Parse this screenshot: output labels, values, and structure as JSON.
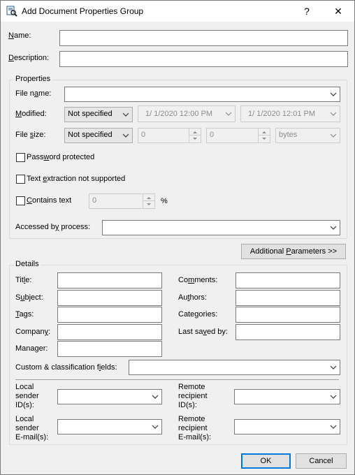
{
  "window": {
    "title": "Add Document Properties Group",
    "help_label": "?",
    "close_label": "✕"
  },
  "top": {
    "name_label": "Name:",
    "name_value": "",
    "description_label": "Description:",
    "description_value": ""
  },
  "properties": {
    "group_title": "Properties",
    "file_name_label": "File name:",
    "file_name_value": "",
    "modified_label": "Modified:",
    "modified_mode": "Not specified",
    "modified_from": "1/  1/2020 12:00 PM",
    "modified_to": "1/  1/2020 12:01 PM",
    "file_size_label": "File size:",
    "file_size_mode": "Not specified",
    "size_min": "0",
    "size_max": "0",
    "size_unit": "bytes",
    "password_protected_label": "Password protected",
    "text_extraction_label": "Text extraction not supported",
    "contains_text_label": "Contains text",
    "contains_text_value": "0",
    "percent_label": "%",
    "accessed_by_label": "Accessed by process:",
    "accessed_by_value": ""
  },
  "additional_parameters_label": "Additional Parameters >>",
  "details": {
    "group_title": "Details",
    "title_label": "Title:",
    "subject_label": "Subject:",
    "tags_label": "Tags:",
    "company_label": "Company:",
    "manager_label": "Manager:",
    "comments_label": "Comments:",
    "authors_label": "Authors:",
    "categories_label": "Categories:",
    "last_saved_label": "Last saved by:",
    "custom_fields_label": "Custom & classification fields:",
    "local_sender_id_label": [
      "Local",
      "sender",
      "ID(s):"
    ],
    "remote_recipient_id_label": [
      "Remote",
      "recipient",
      "ID(s):"
    ],
    "local_sender_email_label": [
      "Local",
      "sender",
      "E-mail(s):"
    ],
    "remote_recipient_email_label": [
      "Remote",
      "recipient",
      "E-mail(s):"
    ]
  },
  "buttons": {
    "ok": "OK",
    "cancel": "Cancel"
  },
  "colors": {
    "focus_blue": "#0078d7",
    "disabled_text": "#8c8c8c",
    "window_bg": "#f0f0f0"
  }
}
